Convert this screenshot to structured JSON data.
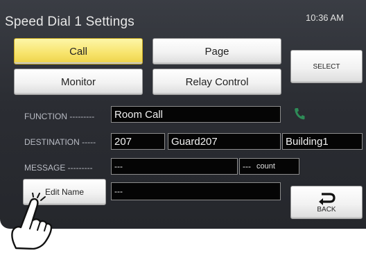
{
  "header": {
    "title": "Speed Dial 1 Settings",
    "time": "10:36 AM"
  },
  "tabs": {
    "call": "Call",
    "page": "Page",
    "monitor": "Monitor",
    "relay": "Relay Control",
    "select": "SELECT"
  },
  "form": {
    "function_label": "FUNCTION ---------",
    "function_value": "Room Call",
    "destination_label": "DESTINATION -----",
    "destination_number": "207",
    "destination_name": "Guard207",
    "destination_building": "Building1",
    "message_label": "MESSAGE ---------",
    "message_value": "---",
    "count_value": "---",
    "count_label": "count",
    "name_value": "---"
  },
  "buttons": {
    "edit_name": "Edit Name",
    "back": "BACK"
  },
  "icons": {
    "phone": "phone-icon",
    "back": "back-arrow-icon",
    "hand": "pointing-hand-icon"
  },
  "colors": {
    "active_tab": "#f7e36a",
    "phone_icon": "#2e8b57"
  }
}
